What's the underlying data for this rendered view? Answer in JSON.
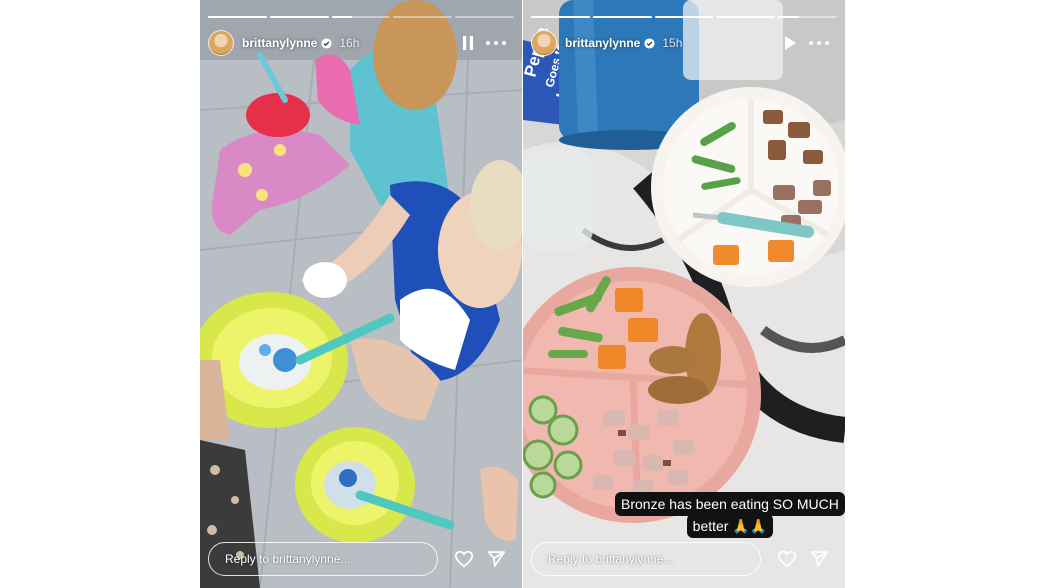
{
  "stories": [
    {
      "username": "brittanylynne",
      "age": "16h",
      "playback": "playing",
      "progress": [
        1,
        1,
        0.35,
        0,
        0
      ],
      "reply_placeholder": "Reply to brittanylynne...",
      "icons": {
        "verified": "verified-badge-icon",
        "control": "pause-icon",
        "more": "more-options-icon",
        "like": "heart-icon",
        "share": "send-icon"
      }
    },
    {
      "username": "brittanylynne",
      "age": "15h",
      "playback": "paused",
      "progress": [
        1,
        1,
        1,
        1,
        0.35
      ],
      "reply_placeholder": "Reply to brittanylynne...",
      "caption": [
        "Bronze has been eating SO MUCH",
        "better 🙏🙏"
      ],
      "book_title": [
        "Peppa",
        "Goes to",
        "London"
      ],
      "icons": {
        "verified": "verified-badge-icon",
        "control": "play-icon",
        "more": "more-options-icon",
        "like": "heart-icon",
        "share": "send-icon"
      }
    }
  ]
}
